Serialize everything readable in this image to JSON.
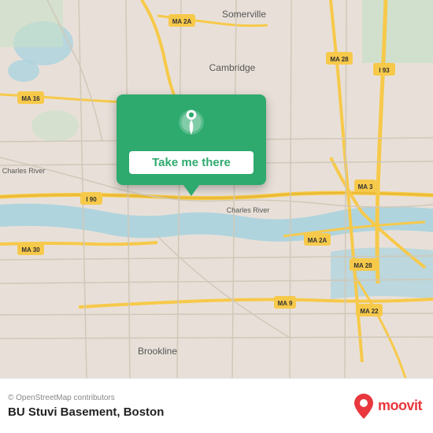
{
  "map": {
    "attribution": "© OpenStreetMap contributors",
    "background_color": "#e8e0d8"
  },
  "popup": {
    "button_label": "Take me there",
    "bg_color": "#2eaa6e"
  },
  "bottom_bar": {
    "location_name": "BU Stuvi Basement, Boston",
    "moovit_label": "moovit"
  }
}
